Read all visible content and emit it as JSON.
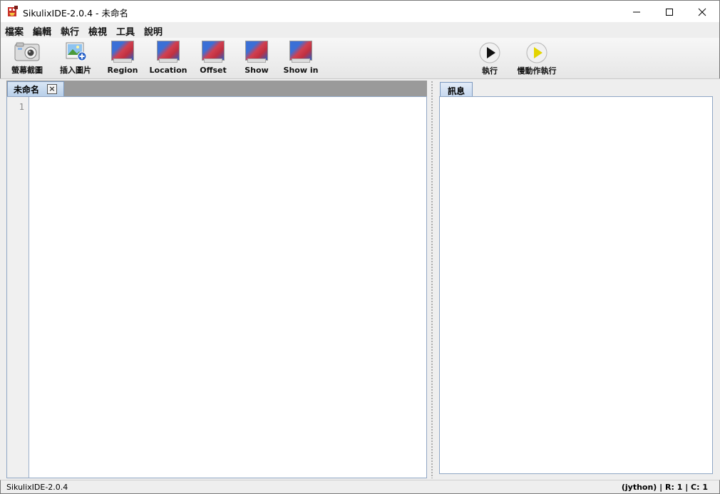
{
  "window": {
    "title": "SikulixIDE-2.0.4 - 未命名"
  },
  "menu": [
    "檔案",
    "編輯",
    "執行",
    "檢視",
    "工具",
    "說明"
  ],
  "toolbar": {
    "screenshot_label": "螢幕截圖",
    "insert_image_label": "插入圖片",
    "region_label": "Region",
    "location_label": "Location",
    "offset_label": "Offset",
    "show_label": "Show",
    "show_in_label": "Show in",
    "run_label": "執行",
    "run_slow_label": "慢動作執行"
  },
  "editor": {
    "tab_label": "未命名",
    "line_number": "1"
  },
  "messages": {
    "tab_label": "訊息"
  },
  "status": {
    "left": "SikulixIDE-2.0.4",
    "right": "(jython) | R: 1 | C: 1"
  },
  "colors": {
    "run_arrow": "#111111",
    "run_slow_arrow": "#e3d400"
  }
}
